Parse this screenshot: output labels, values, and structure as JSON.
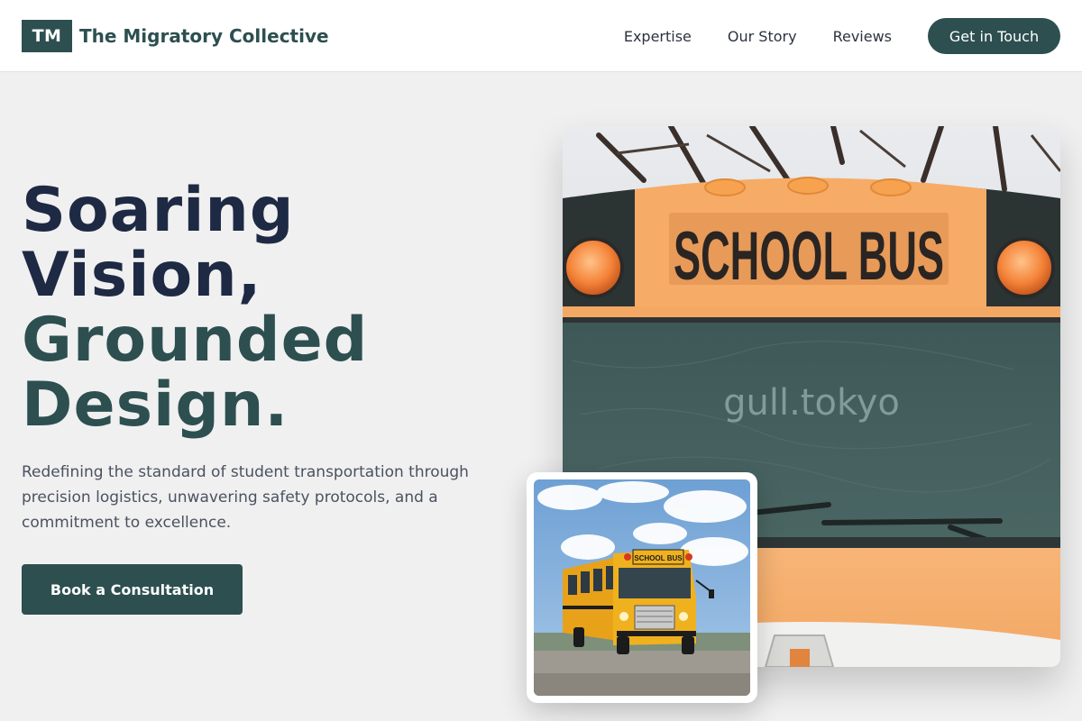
{
  "brand": {
    "mark": "TM",
    "name": "The Migratory Collective"
  },
  "nav": {
    "links": [
      "Expertise",
      "Our Story",
      "Reviews"
    ],
    "cta": "Get in Touch"
  },
  "hero": {
    "title_line1": "Soaring",
    "title_line2": "Vision,",
    "title_line3": "Grounded",
    "title_line4": "Design.",
    "description": "Redefining the standard of student transportation through precision logistics, unwavering safety protocols, and a commitment to excellence.",
    "cta": "Book a Consultation"
  },
  "images": {
    "main": {
      "sign_text": "SCHOOL BUS",
      "watermark": "gull.tokyo"
    },
    "thumbnail": {
      "sign_text": "SCHOOL BUS"
    }
  },
  "colors": {
    "primary": "#2d4f50",
    "heading": "#1e2a44",
    "bus_yellow": "#f5a85c"
  }
}
